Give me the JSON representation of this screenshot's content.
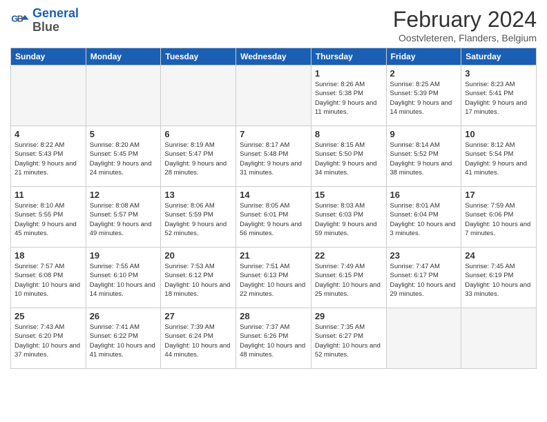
{
  "header": {
    "logo_line1": "General",
    "logo_line2": "Blue",
    "month_title": "February 2024",
    "location": "Oostvleteren, Flanders, Belgium"
  },
  "days_of_week": [
    "Sunday",
    "Monday",
    "Tuesday",
    "Wednesday",
    "Thursday",
    "Friday",
    "Saturday"
  ],
  "weeks": [
    [
      {
        "day": "",
        "empty": true
      },
      {
        "day": "",
        "empty": true
      },
      {
        "day": "",
        "empty": true
      },
      {
        "day": "",
        "empty": true
      },
      {
        "day": "1",
        "sunrise": "8:26 AM",
        "sunset": "5:38 PM",
        "daylight": "9 hours and 11 minutes."
      },
      {
        "day": "2",
        "sunrise": "8:25 AM",
        "sunset": "5:39 PM",
        "daylight": "9 hours and 14 minutes."
      },
      {
        "day": "3",
        "sunrise": "8:23 AM",
        "sunset": "5:41 PM",
        "daylight": "9 hours and 17 minutes."
      }
    ],
    [
      {
        "day": "4",
        "sunrise": "8:22 AM",
        "sunset": "5:43 PM",
        "daylight": "9 hours and 21 minutes."
      },
      {
        "day": "5",
        "sunrise": "8:20 AM",
        "sunset": "5:45 PM",
        "daylight": "9 hours and 24 minutes."
      },
      {
        "day": "6",
        "sunrise": "8:19 AM",
        "sunset": "5:47 PM",
        "daylight": "9 hours and 28 minutes."
      },
      {
        "day": "7",
        "sunrise": "8:17 AM",
        "sunset": "5:48 PM",
        "daylight": "9 hours and 31 minutes."
      },
      {
        "day": "8",
        "sunrise": "8:15 AM",
        "sunset": "5:50 PM",
        "daylight": "9 hours and 34 minutes."
      },
      {
        "day": "9",
        "sunrise": "8:14 AM",
        "sunset": "5:52 PM",
        "daylight": "9 hours and 38 minutes."
      },
      {
        "day": "10",
        "sunrise": "8:12 AM",
        "sunset": "5:54 PM",
        "daylight": "9 hours and 41 minutes."
      }
    ],
    [
      {
        "day": "11",
        "sunrise": "8:10 AM",
        "sunset": "5:55 PM",
        "daylight": "9 hours and 45 minutes."
      },
      {
        "day": "12",
        "sunrise": "8:08 AM",
        "sunset": "5:57 PM",
        "daylight": "9 hours and 49 minutes."
      },
      {
        "day": "13",
        "sunrise": "8:06 AM",
        "sunset": "5:59 PM",
        "daylight": "9 hours and 52 minutes."
      },
      {
        "day": "14",
        "sunrise": "8:05 AM",
        "sunset": "6:01 PM",
        "daylight": "9 hours and 56 minutes."
      },
      {
        "day": "15",
        "sunrise": "8:03 AM",
        "sunset": "6:03 PM",
        "daylight": "9 hours and 59 minutes."
      },
      {
        "day": "16",
        "sunrise": "8:01 AM",
        "sunset": "6:04 PM",
        "daylight": "10 hours and 3 minutes."
      },
      {
        "day": "17",
        "sunrise": "7:59 AM",
        "sunset": "6:06 PM",
        "daylight": "10 hours and 7 minutes."
      }
    ],
    [
      {
        "day": "18",
        "sunrise": "7:57 AM",
        "sunset": "6:08 PM",
        "daylight": "10 hours and 10 minutes."
      },
      {
        "day": "19",
        "sunrise": "7:55 AM",
        "sunset": "6:10 PM",
        "daylight": "10 hours and 14 minutes."
      },
      {
        "day": "20",
        "sunrise": "7:53 AM",
        "sunset": "6:12 PM",
        "daylight": "10 hours and 18 minutes."
      },
      {
        "day": "21",
        "sunrise": "7:51 AM",
        "sunset": "6:13 PM",
        "daylight": "10 hours and 22 minutes."
      },
      {
        "day": "22",
        "sunrise": "7:49 AM",
        "sunset": "6:15 PM",
        "daylight": "10 hours and 25 minutes."
      },
      {
        "day": "23",
        "sunrise": "7:47 AM",
        "sunset": "6:17 PM",
        "daylight": "10 hours and 29 minutes."
      },
      {
        "day": "24",
        "sunrise": "7:45 AM",
        "sunset": "6:19 PM",
        "daylight": "10 hours and 33 minutes."
      }
    ],
    [
      {
        "day": "25",
        "sunrise": "7:43 AM",
        "sunset": "6:20 PM",
        "daylight": "10 hours and 37 minutes."
      },
      {
        "day": "26",
        "sunrise": "7:41 AM",
        "sunset": "6:22 PM",
        "daylight": "10 hours and 41 minutes."
      },
      {
        "day": "27",
        "sunrise": "7:39 AM",
        "sunset": "6:24 PM",
        "daylight": "10 hours and 44 minutes."
      },
      {
        "day": "28",
        "sunrise": "7:37 AM",
        "sunset": "6:26 PM",
        "daylight": "10 hours and 48 minutes."
      },
      {
        "day": "29",
        "sunrise": "7:35 AM",
        "sunset": "6:27 PM",
        "daylight": "10 hours and 52 minutes."
      },
      {
        "day": "",
        "empty": true
      },
      {
        "day": "",
        "empty": true
      }
    ]
  ]
}
